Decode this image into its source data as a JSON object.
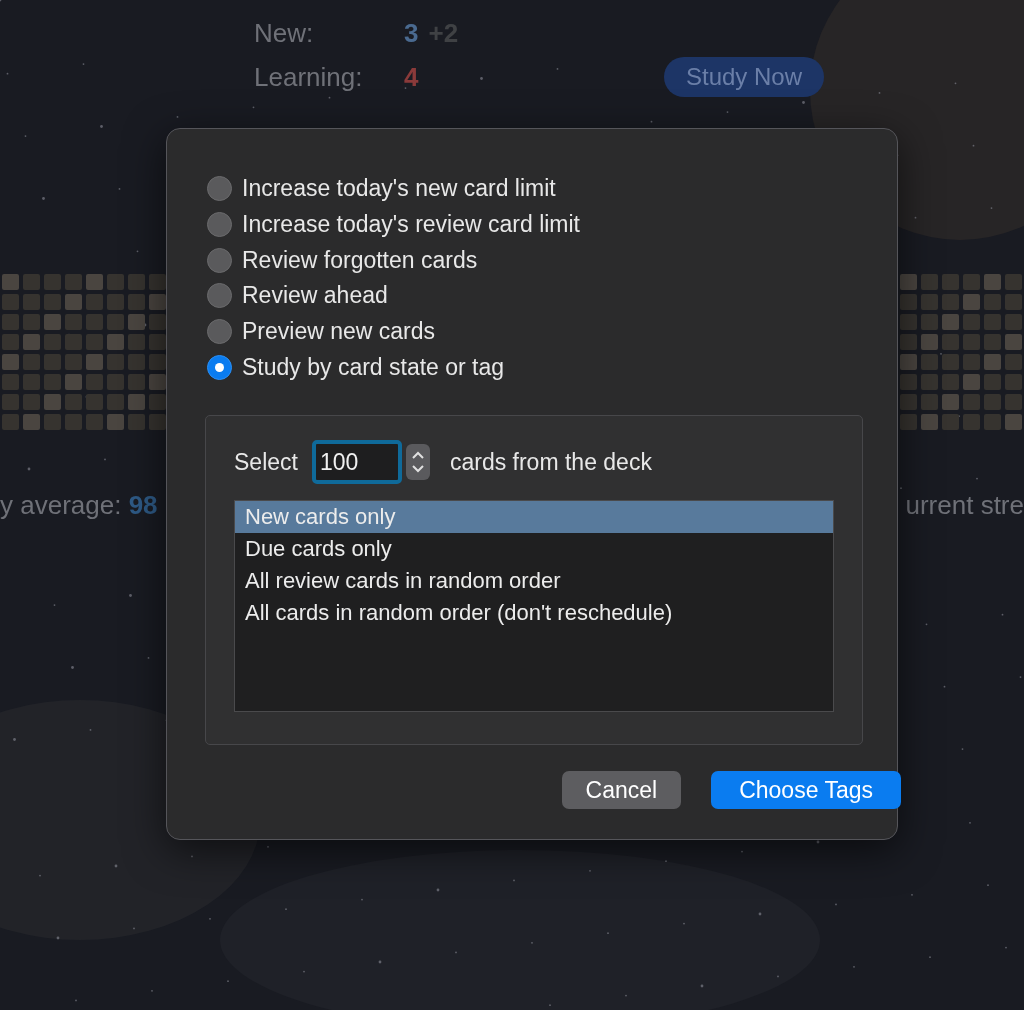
{
  "deck_overview": {
    "rows": [
      {
        "label": "New:",
        "count": "3",
        "kind": "new",
        "extra": "+2"
      },
      {
        "label": "Learning:",
        "count": "4",
        "kind": "learning",
        "extra": ""
      }
    ],
    "study_button": "Study Now",
    "stats_left": {
      "label": "y average:",
      "value": "98"
    },
    "stats_right": "urrent stre"
  },
  "dialog": {
    "options": [
      {
        "label": "Increase today's new card limit",
        "selected": false
      },
      {
        "label": "Increase today's review card limit",
        "selected": false
      },
      {
        "label": "Review forgotten cards",
        "selected": false
      },
      {
        "label": "Review ahead",
        "selected": false
      },
      {
        "label": "Preview new cards",
        "selected": false
      },
      {
        "label": "Study by card state or tag",
        "selected": true
      }
    ],
    "select_label": "Select",
    "count_value": "100",
    "count_suffix": "cards from the deck",
    "choices": [
      {
        "label": "New cards only",
        "selected": true
      },
      {
        "label": "Due cards only",
        "selected": false
      },
      {
        "label": "All review cards in random order",
        "selected": false
      },
      {
        "label": "All cards in random order (don't reschedule)",
        "selected": false
      }
    ],
    "buttons": [
      {
        "label": "Cancel",
        "kind": "secondary"
      },
      {
        "label": "Choose Tags",
        "kind": "primary"
      }
    ]
  }
}
